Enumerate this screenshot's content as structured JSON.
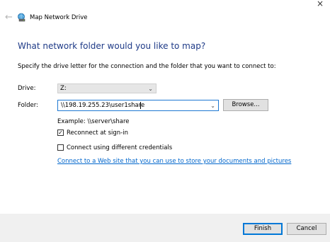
{
  "window": {
    "title": "Map Network Drive",
    "close_glyph": "×",
    "back_glyph": "←"
  },
  "main": {
    "heading": "What network folder would you like to map?",
    "instruction": "Specify the drive letter for the connection and the folder that you want to connect to:",
    "drive_label": "Drive:",
    "drive_value": "Z:",
    "folder_label": "Folder:",
    "folder_value": "\\\\198.19.255.23\\user1share",
    "browse_label": "Browse...",
    "example_text": "Example: \\\\server\\share",
    "reconnect_label": "Reconnect at sign-in",
    "reconnect_checked": true,
    "different_credentials_label": "Connect using different credentials",
    "different_credentials_checked": false,
    "web_link": "Connect to a Web site that you can use to store your documents and pictures"
  },
  "footer": {
    "finish_label": "Finish",
    "cancel_label": "Cancel"
  },
  "glyphs": {
    "chevron": "⌄",
    "check": "✓"
  },
  "icons": {
    "title_icon": "network-drive-icon"
  },
  "colors": {
    "heading": "#1e3a87",
    "link": "#0066cc",
    "focus_border": "#0078d7"
  }
}
